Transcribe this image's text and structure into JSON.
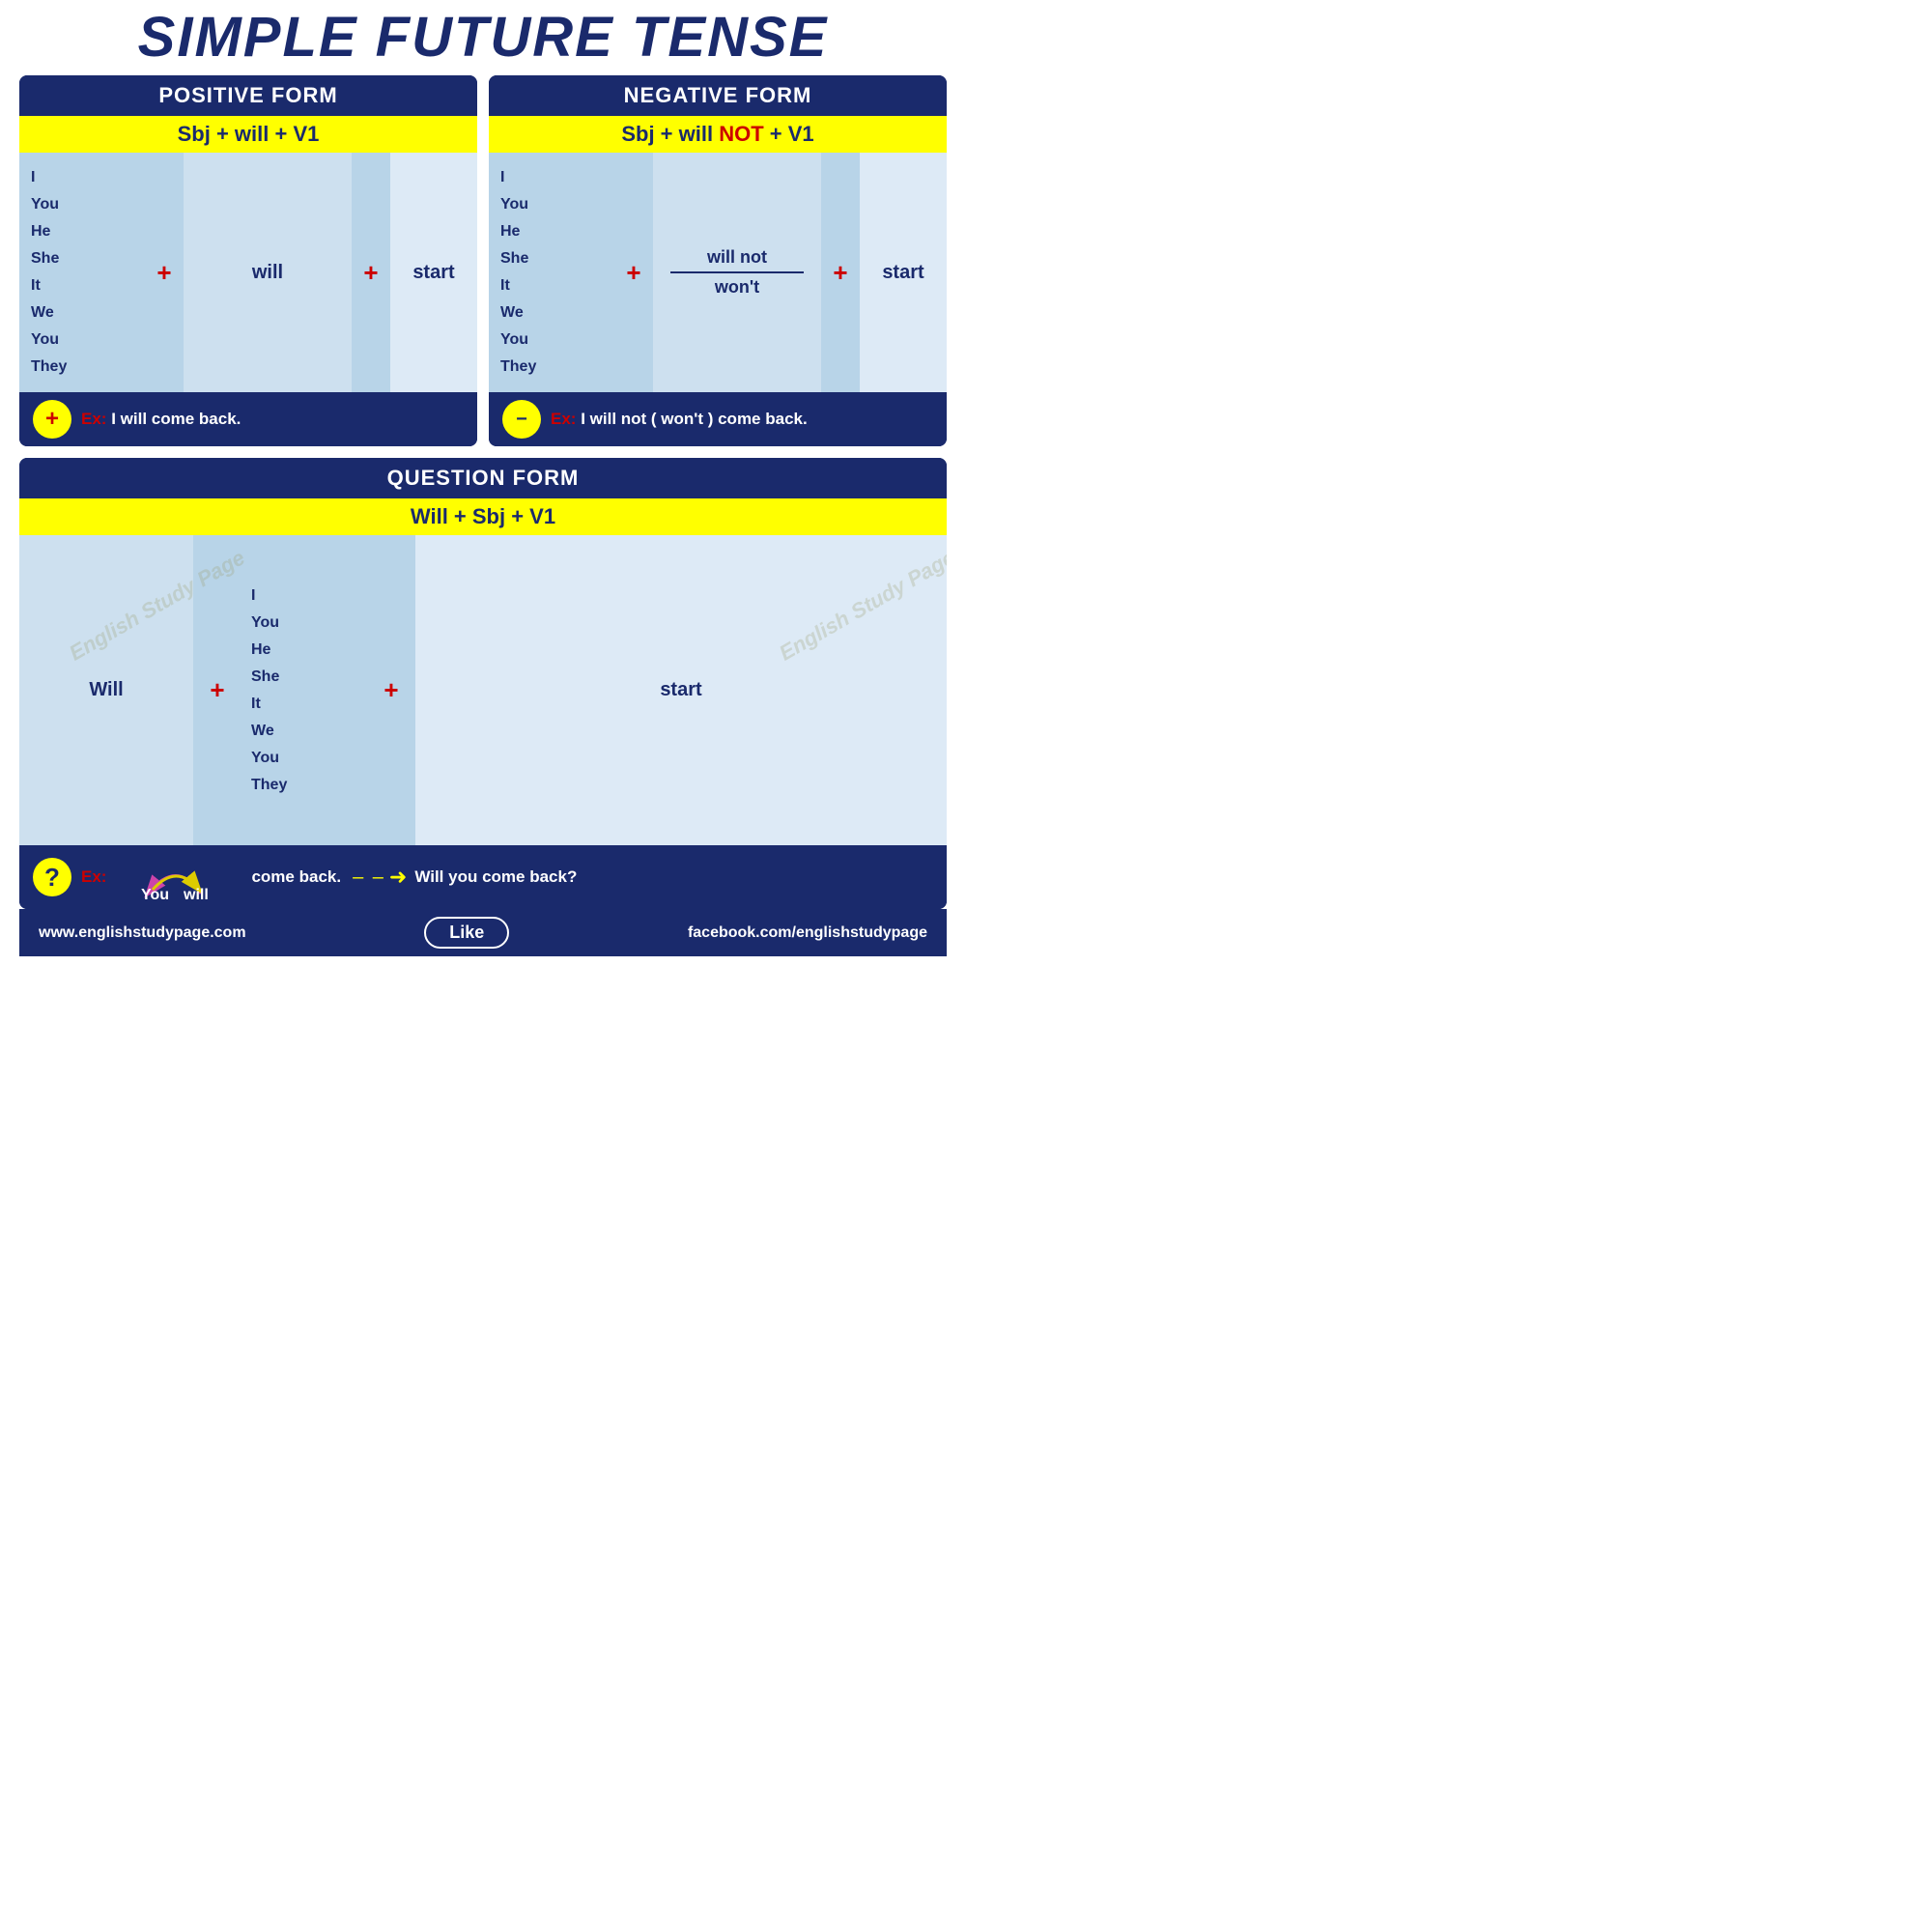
{
  "title": "SIMPLE FUTURE TENSE",
  "positive": {
    "header": "POSITIVE FORM",
    "formula": "Sbj + will + V1",
    "subjects": "I\nYou\nHe\nShe\nIt\nWe\nYou\nThey",
    "will": "will",
    "verb": "start",
    "example_label": "Ex:",
    "example": "I will come back."
  },
  "negative": {
    "header": "NEGATIVE FORM",
    "formula_pre": "Sbj + will ",
    "formula_not": "NOT",
    "formula_post": " + V1",
    "subjects": "I\nYou\nHe\nShe\nIt\nWe\nYou\nThey",
    "will_not": "will not",
    "wont": "won't",
    "verb": "start",
    "example_label": "Ex:",
    "example": "I will not ( won't ) come back."
  },
  "question": {
    "header": "QUESTION FORM",
    "formula": "Will +  Sbj + V1",
    "will": "Will",
    "subjects": "I\nYou\nHe\nShe\nIt\nWe\nYou\nThey",
    "verb": "start",
    "example_label": "Ex:",
    "you_word": "You",
    "will_word": "will",
    "come_back": "come back.",
    "arrow_label": "➜",
    "answer": "Will you come back?"
  },
  "footer": {
    "left": "www.englishstudypage.com",
    "like": "Like",
    "right": "facebook.com/englishstudypage"
  }
}
